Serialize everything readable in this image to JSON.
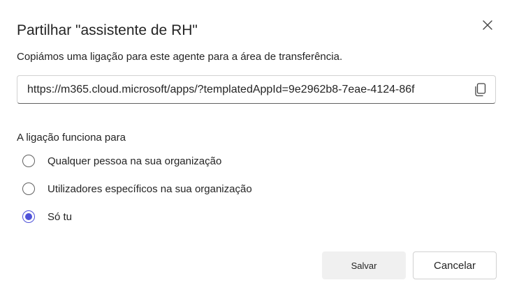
{
  "dialog": {
    "title": "Partilhar \"assistente de RH\"",
    "description": "Copiámos uma ligação para este agente para a área de transferência.",
    "close_icon": "close-icon"
  },
  "link": {
    "value": "https://m365.cloud.microsoft/apps/?templatedAppId=9e2962b8-7eae-4124-86f",
    "copy_icon": "copy-icon"
  },
  "access": {
    "label": "A ligação funciona para",
    "options": [
      {
        "label": "Qualquer pessoa na sua organização",
        "selected": false
      },
      {
        "label": "Utilizadores específicos na sua organização",
        "selected": false
      },
      {
        "label": "Só tu",
        "selected": true
      }
    ]
  },
  "buttons": {
    "save": "Salvar",
    "cancel": "Cancelar"
  },
  "colors": {
    "accent": "#4f52d9",
    "text": "#242424",
    "border": "#d1d1d1",
    "button_disabled_bg": "#f0f0f0"
  }
}
